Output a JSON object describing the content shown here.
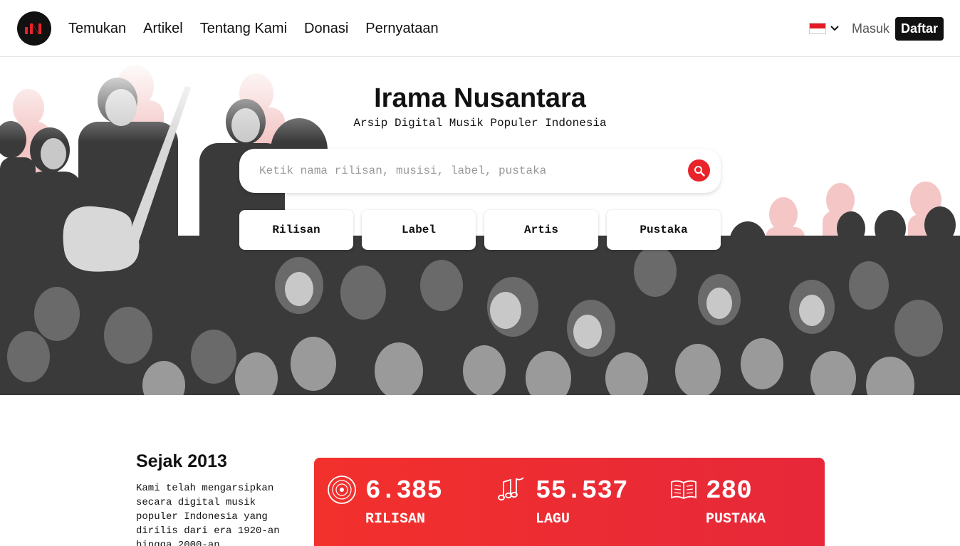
{
  "nav": {
    "links": [
      "Temukan",
      "Artikel",
      "Tentang Kami",
      "Donasi",
      "Pernyataan"
    ],
    "login_label": "Masuk",
    "register_label": "Daftar",
    "language_flag": "indonesia-flag-icon"
  },
  "hero": {
    "title": "Irama Nusantara",
    "subtitle": "Arsip Digital Musik Populer Indonesia",
    "search_placeholder": "Ketik nama rilisan, musisi, label, pustaka",
    "categories": [
      "Rilisan",
      "Label",
      "Artis",
      "Pustaka"
    ]
  },
  "about": {
    "title": "Sejak 2013",
    "text": "Kami telah mengarsipkan secara digital musik populer Indonesia yang dirilis dari era 1920-an hingga 2000-an"
  },
  "stats": [
    {
      "value": "6.385",
      "label": "RILISAN",
      "icon": "vinyl-record-icon"
    },
    {
      "value": "55.537",
      "label": "LAGU",
      "icon": "music-notes-icon"
    },
    {
      "value": "280",
      "label": "PUSTAKA",
      "icon": "open-book-icon"
    }
  ],
  "colors": {
    "accent": "#e8232a",
    "dark": "#111111",
    "stats_gradient_start": "#f2302c",
    "stats_gradient_end": "#e6283a"
  }
}
